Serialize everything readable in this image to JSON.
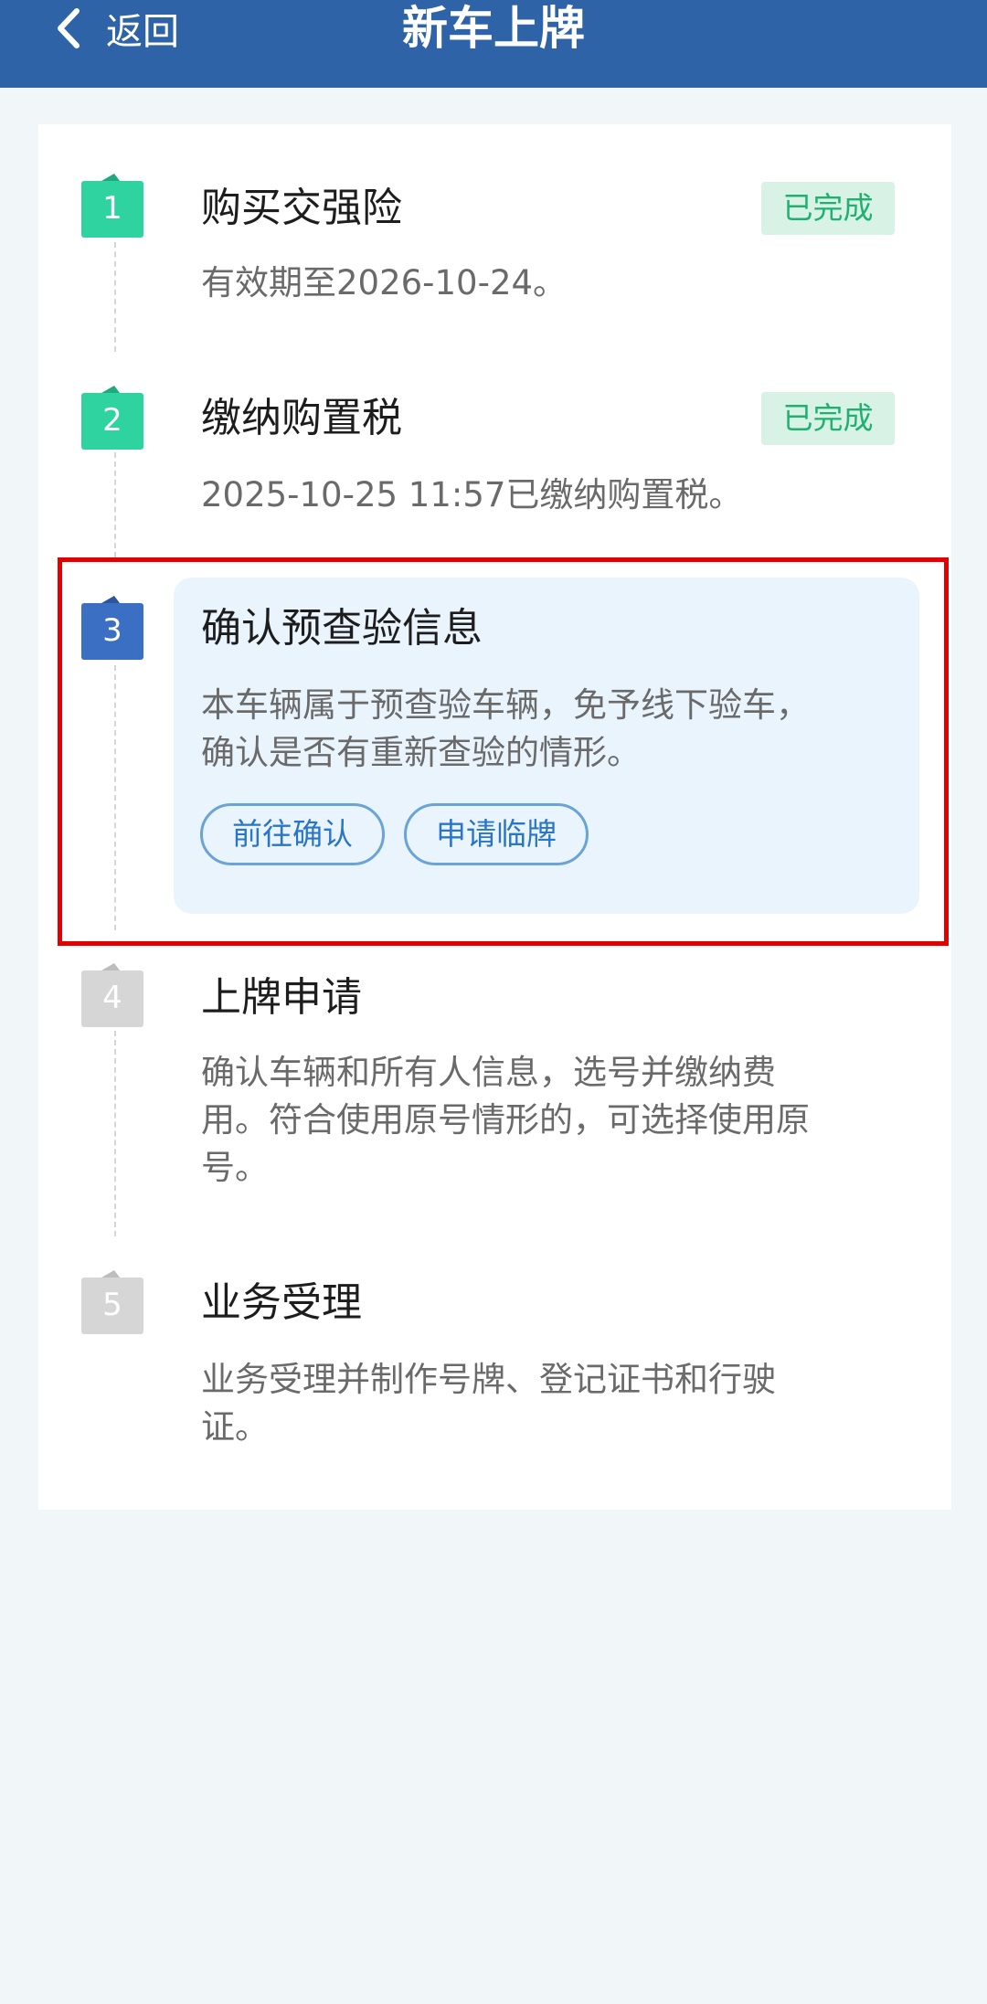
{
  "header": {
    "back_label": "返回",
    "title": "新车上牌"
  },
  "steps": [
    {
      "number": "1",
      "title": "购买交强险",
      "desc_lines": [
        "有效期至2026-10-24。"
      ],
      "status": "已完成",
      "state": "completed"
    },
    {
      "number": "2",
      "title": "缴纳购置税",
      "desc_lines": [
        "2025-10-25 11:57已缴纳购置税。"
      ],
      "status": "已完成",
      "state": "completed"
    },
    {
      "number": "3",
      "title": "确认预查验信息",
      "desc_lines": [
        "本车辆属于预查验车辆，免予线下验车，",
        "确认是否有重新查验的情形。"
      ],
      "state": "current",
      "actions": [
        "前往确认",
        "申请临牌"
      ]
    },
    {
      "number": "4",
      "title": "上牌申请",
      "desc_lines": [
        "确认车辆和所有人信息，选号并缴纳费",
        "用。符合使用原号情形的，可选择使用原",
        "号。"
      ],
      "state": "pending"
    },
    {
      "number": "5",
      "title": "业务受理",
      "desc_lines": [
        "业务受理并制作号牌、登记证书和行驶",
        "证。"
      ],
      "state": "pending"
    }
  ],
  "colors": {
    "header": "#2f63a7",
    "completed": "#2ed3a0",
    "current": "#3a6fc4",
    "pending": "#d6d6d6",
    "status_text": "#20b170",
    "highlight_frame": "#e20000"
  },
  "icons": {
    "back": "chevron-left-icon"
  }
}
